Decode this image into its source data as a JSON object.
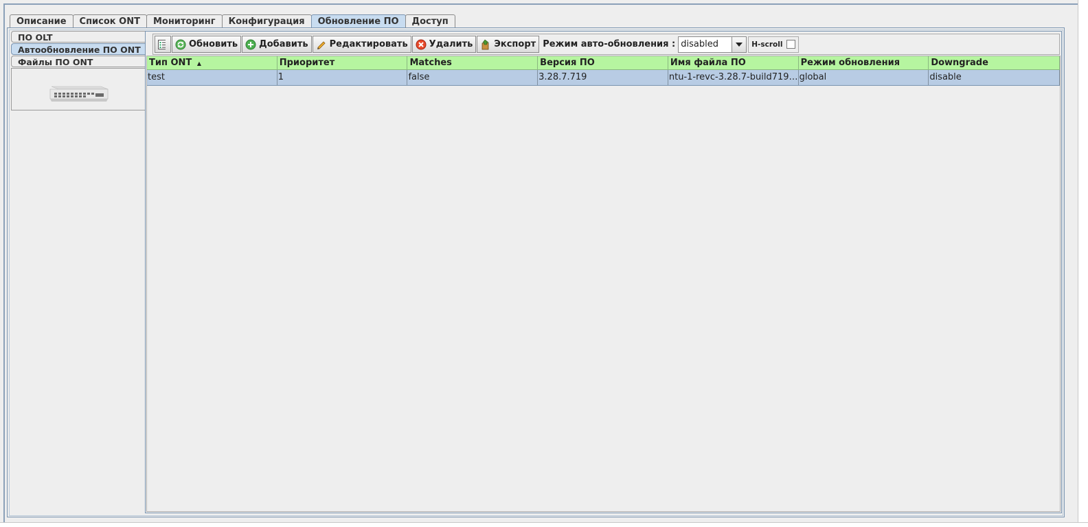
{
  "tabs": [
    {
      "label": "Описание"
    },
    {
      "label": "Список ONT"
    },
    {
      "label": "Мониторинг"
    },
    {
      "label": "Конфигурация"
    },
    {
      "label": "Обновление ПО",
      "active": true
    },
    {
      "label": "Доступ"
    }
  ],
  "side_tabs": [
    {
      "label": "ПО OLT"
    },
    {
      "label": "Автообновление ПО ONT",
      "active": true
    },
    {
      "label": "Файлы ПО ONT"
    }
  ],
  "toolbar": {
    "refresh_label": "Обновить",
    "add_label": "Добавить",
    "edit_label": "Редактировать",
    "delete_label": "Удалить",
    "export_label": "Экспорт",
    "auto_update_label": "Режим авто-обновления :",
    "auto_update_value": "disabled",
    "hscroll_label": "H-scroll",
    "hscroll_checked": false
  },
  "table": {
    "columns": [
      "Тип ONT",
      "Приоритет",
      "Matches",
      "Версия ПО",
      "Имя файла ПО",
      "Режим обновления",
      "Downgrade"
    ],
    "sort_indicator": "▲",
    "rows": [
      [
        "test",
        "1",
        "false",
        "3.28.7.719",
        "ntu-1-revc-3.28.7-build719.f...",
        "global",
        "disable"
      ]
    ]
  },
  "colors": {
    "header_bg": "#b6f5a0",
    "selected_row_bg": "#b8cce4",
    "active_tab_bg": "#c8dcf0"
  }
}
